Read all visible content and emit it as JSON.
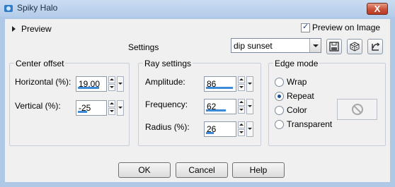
{
  "window": {
    "title": "Spiky Halo",
    "close_label": "X"
  },
  "preview": {
    "label": "Preview",
    "on_image_label": "Preview on Image",
    "on_image_checked": true
  },
  "settings": {
    "label": "Settings",
    "preset": "dip sunset"
  },
  "toolbar": {
    "icons": [
      "save-icon",
      "randomize-dice-icon",
      "reset-icon"
    ]
  },
  "center_offset": {
    "title": "Center offset",
    "horizontal": {
      "label": "Horizontal (%):",
      "value": "19,00",
      "fill": 0.8
    },
    "vertical": {
      "label": "Vertical (%):",
      "value": "-25",
      "fill": 0.35
    }
  },
  "ray_settings": {
    "title": "Ray settings",
    "amplitude": {
      "label": "Amplitude:",
      "value": "86",
      "fill": 0.95
    },
    "frequency": {
      "label": "Frequency:",
      "value": "62",
      "fill": 0.7
    },
    "radius": {
      "label": "Radius (%):",
      "value": "26",
      "fill": 0.28
    }
  },
  "edge_mode": {
    "title": "Edge mode",
    "options": [
      "Wrap",
      "Repeat",
      "Color",
      "Transparent"
    ],
    "selected": "Repeat"
  },
  "buttons": {
    "ok": "OK",
    "cancel": "Cancel",
    "help": "Help"
  },
  "colors": {
    "titlebar": "#b4cce9",
    "accent": "#3d8ad9",
    "close": "#c9503a"
  }
}
